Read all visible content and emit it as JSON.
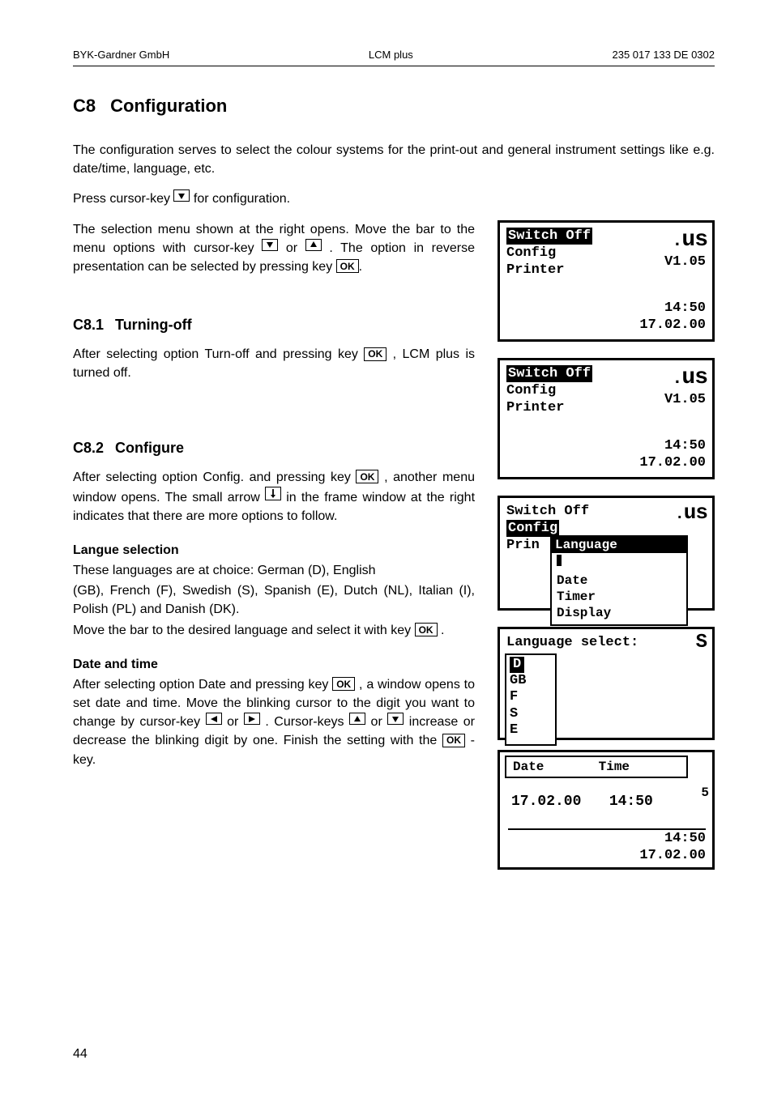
{
  "header": {
    "left": "BYK-Gardner GmbH",
    "center": "LCM plus",
    "right": "235 017 133 DE 0302"
  },
  "h1": {
    "num": "C8",
    "title": "Configuration"
  },
  "intro": "The configuration serves to select the colour systems for the print-out and general instrument settings like e.g. date/time, language, etc.",
  "press_line": {
    "before": "Press cursor-key ",
    "after": " for configuration."
  },
  "selection_para": {
    "a": "The selection menu shown at the right opens.  Move the bar to the menu options with cursor-key ",
    "b": " or ",
    "c": " .   The option in reverse presentation can be selected by pressing key  ",
    "d": "."
  },
  "ok_label": "OK",
  "sec81": {
    "num": "C8.1",
    "title": "Turning-off"
  },
  "sec81_para": {
    "a": "After selecting option Turn-off and pressing key  ",
    "b": " , LCM plus is turned off."
  },
  "sec82": {
    "num": "C8.2",
    "title": "Configure"
  },
  "sec82_para": {
    "a": "After selecting option Config. and pressing key  ",
    "b": " , another menu window opens.   The small arrow   ",
    "c": "  in the frame window  at the right indicates that there are more options to follow."
  },
  "langue_h": "Langue selection",
  "langue_p1": "These languages are at choice: German (D), English",
  "langue_p2": "(GB), French (F), Swedish (S), Spanish (E), Dutch (NL), Italian (I), Polish (PL) and Danish (DK).",
  "langue_p3": {
    "a": "Move the bar to the desired language and select it with key ",
    "b": " ."
  },
  "date_h": "Date and time",
  "date_p": {
    "a": "After selecting option Date and pressing key  ",
    "b": " , a window opens to set date and time.  Move the blinking cursor to the digit you want to change by cursor-key ",
    "c": " or ",
    "d": " .  Cursor-keys ",
    "e": " or ",
    "f": " increase or decrease the blinking digit by one.  Finish the setting with the  ",
    "g": " -key."
  },
  "panel_common": {
    "brand": "us",
    "brand_prefix_dot": ".",
    "version": "V1.05",
    "time": "14:50",
    "date": "17.02.00"
  },
  "panel1": {
    "line1_hl": "Switch Off",
    "line2": "Config",
    "line3": "Printer"
  },
  "panel2": {
    "line1_hl": "Switch Off",
    "line2": "Config",
    "line3": "Printer"
  },
  "panel3": {
    "line1": "Switch Off",
    "line2_hl": "Config",
    "line3": "Prin",
    "sub_hl": "Language",
    "sub_items": [
      "Date",
      "Timer",
      "Display"
    ]
  },
  "panel4": {
    "title": "Language select:",
    "brand_letter": "S",
    "langs": [
      "D",
      "GB",
      "F",
      "S",
      "E"
    ]
  },
  "panel5": {
    "hdr_date": "Date",
    "hdr_time": "Time",
    "val_date": "17.02.00",
    "val_time": "14:50",
    "foot_time": "14:50",
    "foot_date": "17.02.00",
    "tick5": "5"
  },
  "page_num": "44"
}
